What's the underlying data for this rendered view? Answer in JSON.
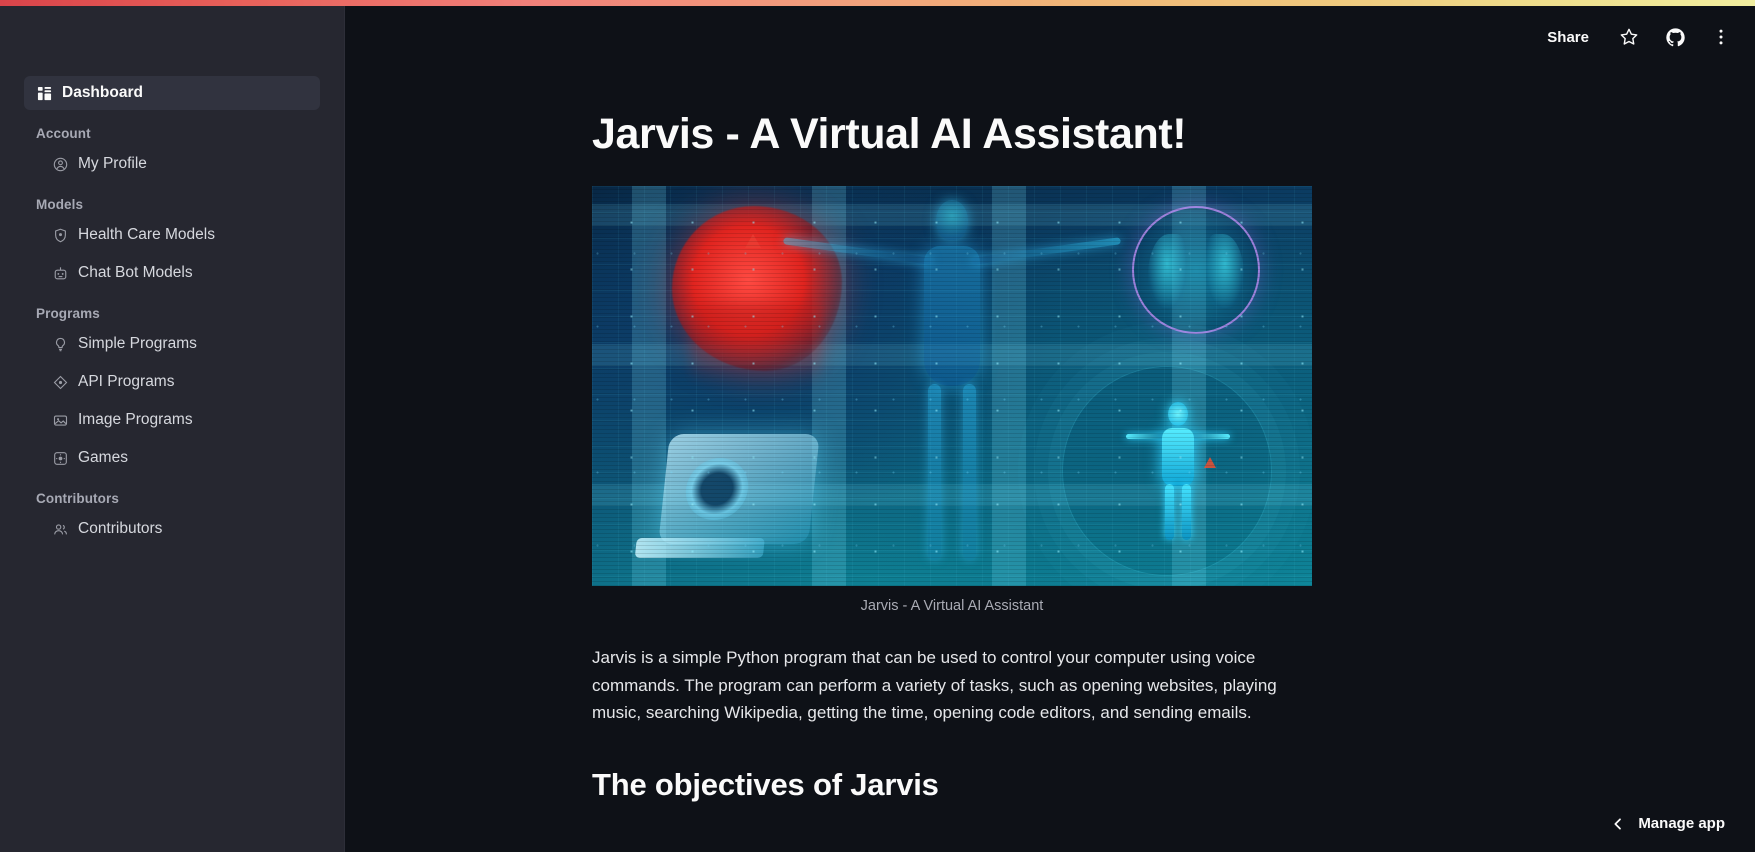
{
  "app": {
    "theme_bg": "#0e1117",
    "sidebar_bg": "#262730",
    "accent": "#ff4b4b",
    "progress_gradient_start": "#d9444a",
    "progress_gradient_end": "#f0eea0"
  },
  "toolbar": {
    "share_label": "Share",
    "star_icon": "star-icon",
    "github_icon": "github-icon",
    "menu_icon": "kebab-menu-icon"
  },
  "sidebar": {
    "nav": [
      {
        "type": "item",
        "label": "Dashboard",
        "icon": "dashboard-icon",
        "active": true
      },
      {
        "type": "group",
        "label": "Account"
      },
      {
        "type": "item",
        "label": "My Profile",
        "icon": "user-circle-icon",
        "active": false
      },
      {
        "type": "group",
        "label": "Models"
      },
      {
        "type": "item",
        "label": "Health Care Models",
        "icon": "shield-icon",
        "active": false
      },
      {
        "type": "item",
        "label": "Chat Bot Models",
        "icon": "robot-icon",
        "active": false
      },
      {
        "type": "group",
        "label": "Programs"
      },
      {
        "type": "item",
        "label": "Simple Programs",
        "icon": "lightbulb-icon",
        "active": false
      },
      {
        "type": "item",
        "label": "API Programs",
        "icon": "diamond-move-icon",
        "active": false
      },
      {
        "type": "item",
        "label": "Image Programs",
        "icon": "image-icon",
        "active": false
      },
      {
        "type": "item",
        "label": "Games",
        "icon": "gamepad-icon",
        "active": false
      },
      {
        "type": "group",
        "label": "Contributors"
      },
      {
        "type": "item",
        "label": "Contributors",
        "icon": "users-icon",
        "active": false
      }
    ]
  },
  "main": {
    "title": "Jarvis - A Virtual AI Assistant!",
    "hero_caption": "Jarvis - A Virtual AI Assistant",
    "paragraph": "Jarvis is a simple Python program that can be used to control your computer using voice commands. The program can perform a variety of tasks, such as opening websites, playing music, searching Wikipedia, getting the time, opening code editors, and sending emails.",
    "section_heading": "The objectives of Jarvis"
  },
  "footer": {
    "manage_app_label": "Manage app",
    "chevron_icon": "chevron-left-icon"
  }
}
